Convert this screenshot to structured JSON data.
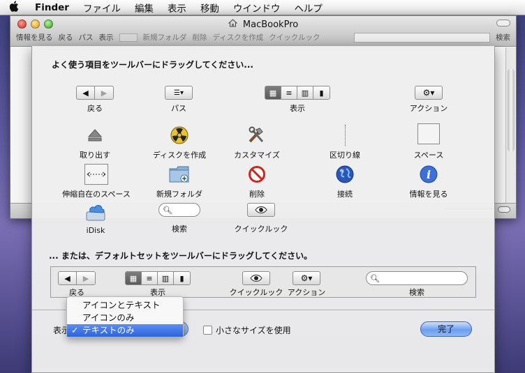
{
  "menubar": {
    "apple": "",
    "items": [
      "Finder",
      "ファイル",
      "編集",
      "表示",
      "移動",
      "ウインドウ",
      "ヘルプ"
    ]
  },
  "finder": {
    "title": "MacBookPro",
    "toolbar_labels": [
      "情報を見る",
      "戻る",
      "パス",
      "表示",
      "新規フォルダ",
      "削除",
      "ディスクを作成",
      "クイックルック",
      "検索"
    ]
  },
  "sheet": {
    "heading_items": "よく使う項目をツールバーにドラッグしてください...",
    "heading_default": "... または、デフォルトセットをツールバーにドラッグしてください。",
    "items": {
      "back": "戻る",
      "path": "パス",
      "view": "表示",
      "action": "アクション",
      "eject": "取り出す",
      "burn": "ディスクを作成",
      "customize": "カスタマイズ",
      "separator": "区切り線",
      "space": "スペース",
      "flexspace": "伸縮自在のスペース",
      "newfolder": "新規フォルダ",
      "delete": "削除",
      "connect": "接続",
      "getinfo": "情報を見る",
      "idisk": "iDisk",
      "search": "検索",
      "quicklook": "クイックルック"
    },
    "default_set": {
      "back": "戻る",
      "view": "表示",
      "quicklook": "クイックルック",
      "action": "アクション",
      "search": "検索"
    },
    "show_label": "表示",
    "small_size_label": "小さなサイズを使用",
    "done_label": "完了"
  },
  "dropdown": {
    "options": [
      "アイコンとテキスト",
      "アイコンのみ",
      "テキストのみ"
    ],
    "selected": "テキストのみ",
    "check": "✓"
  },
  "colors": {
    "selection": "#2b63e0",
    "done_button": "#6d9ff1"
  }
}
